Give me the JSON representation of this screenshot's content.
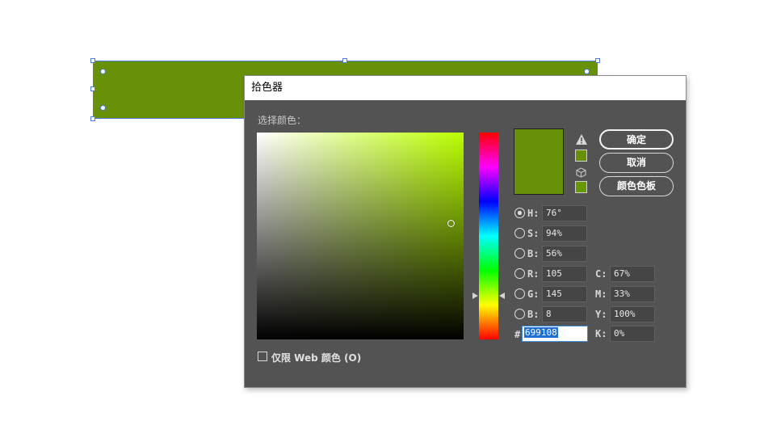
{
  "dialog": {
    "title": "拾色器",
    "select_label": "选择颜色：",
    "buttons": {
      "ok": "确定",
      "cancel": "取消",
      "swatches": "颜色色板"
    },
    "web_only_label": "仅限 Web 颜色 (O)",
    "hex_label": "#",
    "hex_value": "699108"
  },
  "colors": {
    "current": "#699108",
    "shape_fill": "#699108",
    "selection_blue": "#4a7bd6",
    "gamut_swatch": "#699108",
    "websafe_swatch": "#669900"
  },
  "icons": {
    "gamut_warning": "warning-triangle-icon",
    "websafe": "cube-icon"
  },
  "hsb": [
    {
      "key": "h",
      "label": "H:",
      "value": "76°",
      "selected": true
    },
    {
      "key": "s",
      "label": "S:",
      "value": "94%",
      "selected": false
    },
    {
      "key": "b",
      "label": "B:",
      "value": "56%",
      "selected": false
    }
  ],
  "rgb": [
    {
      "key": "r",
      "label": "R:",
      "value": "105",
      "selected": false
    },
    {
      "key": "g",
      "label": "G:",
      "value": "145",
      "selected": false
    },
    {
      "key": "b",
      "label": "B:",
      "value": "8",
      "selected": false
    }
  ],
  "cmyk": [
    {
      "key": "c",
      "label": "C:",
      "value": "67%"
    },
    {
      "key": "m",
      "label": "M:",
      "value": "33%"
    },
    {
      "key": "y",
      "label": "Y:",
      "value": "100%"
    },
    {
      "key": "k",
      "label": "K:",
      "value": "0%"
    }
  ],
  "picker_state": {
    "saturation_fraction": 0.94,
    "brightness_fraction": 0.56,
    "hue_degrees": 76
  }
}
